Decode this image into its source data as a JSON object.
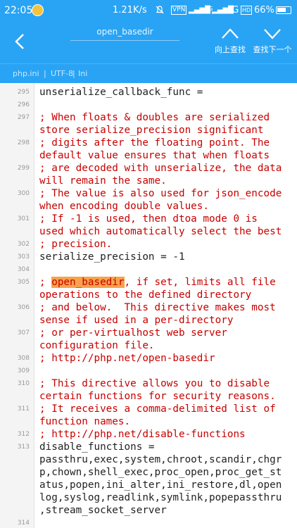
{
  "status_bar": {
    "time": "22:05",
    "network_speed": "1.21K/s",
    "mute_icon": "bell-off-icon",
    "vpn": "VPN",
    "signal_1": "▂▄▆█",
    "network_type_small": "4G",
    "signal_2": "▂▄▆█",
    "network_type": "4G",
    "hd": "HD",
    "battery_percent": "66%"
  },
  "app_bar": {
    "title": "open_basedir",
    "find_prev_label": "向上查找",
    "find_next_label": "查找下一个",
    "colors": {
      "bar": "#29a4f5",
      "comment": "#c80000",
      "highlight": "#f7a24a"
    }
  },
  "file_info": {
    "file_name": "php.ini",
    "separator": "|",
    "encoding": "UTF-8",
    "language": "Ini"
  },
  "editor": {
    "lines": [
      {
        "number": "295",
        "type": "normal",
        "text": "unserialize_callback_func ="
      },
      {
        "number": "296",
        "type": "normal",
        "text": ""
      },
      {
        "number": "297",
        "type": "comment",
        "text": "; When floats & doubles are serialized\nstore serialize_precision significant"
      },
      {
        "number": "298",
        "type": "comment",
        "text": "; digits after the floating point. The\ndefault value ensures that when floats"
      },
      {
        "number": "299",
        "type": "comment",
        "text": "; are decoded with unserialize, the data\nwill remain the same."
      },
      {
        "number": "300",
        "type": "comment",
        "text": "; The value is also used for json_encode\nwhen encoding double values."
      },
      {
        "number": "301",
        "type": "comment",
        "text": "; If -1 is used, then dtoa mode 0 is\nused which automatically select the best"
      },
      {
        "number": "302",
        "type": "comment",
        "text": "; precision."
      },
      {
        "number": "303",
        "type": "normal",
        "text": "serialize_precision = -1"
      },
      {
        "number": "304",
        "type": "normal",
        "text": ""
      },
      {
        "number": "305",
        "type": "highlight",
        "prefix": "; ",
        "highlight": "open_basedir",
        "rest": ", if set, limits all file\noperations to the defined directory"
      },
      {
        "number": "306",
        "type": "comment",
        "text": "; and below.  This directive makes most\nsense if used in a per-directory"
      },
      {
        "number": "307",
        "type": "comment",
        "text": "; or per-virtualhost web server\nconfiguration file."
      },
      {
        "number": "308",
        "type": "comment",
        "text": "; http://php.net/open-basedir"
      },
      {
        "number": "309",
        "type": "normal",
        "text": ""
      },
      {
        "number": "310",
        "type": "comment",
        "text": "; This directive allows you to disable\ncertain functions for security reasons."
      },
      {
        "number": "311",
        "type": "comment",
        "text": "; It receives a comma-delimited list of\nfunction names."
      },
      {
        "number": "312",
        "type": "comment",
        "text": "; http://php.net/disable-functions"
      },
      {
        "number": "313",
        "type": "normal",
        "text": "disable_functions =\npassthru,exec,system,chroot,scandir,chgr\np,chown,shell_exec,proc_open,proc_get_st\natus,popen,ini_alter,ini_restore,dl,open\nlog,syslog,readlink,symlink,popepassthru\n,stream_socket_server"
      },
      {
        "number": "314",
        "type": "normal",
        "text": ""
      }
    ]
  }
}
